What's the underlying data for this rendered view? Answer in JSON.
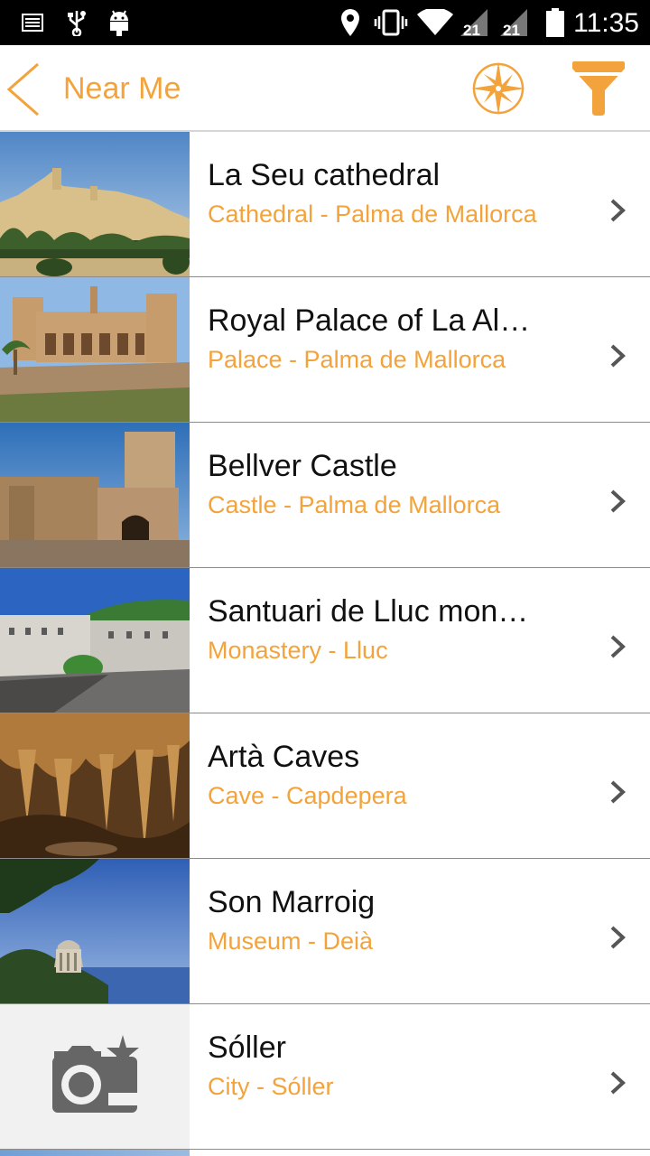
{
  "status_bar": {
    "time": "11:35",
    "icons": [
      "keyboard-icon",
      "usb-icon",
      "android-icon",
      "location-icon",
      "vibrate-icon",
      "wifi-icon",
      "signal-1-icon",
      "signal-2-icon",
      "battery-icon"
    ],
    "sim1_label": "21",
    "sim2_label": "21"
  },
  "app_bar": {
    "title": "Near Me",
    "accent_color": "#f3a33b",
    "icons": [
      "back-arrow-icon",
      "compass-icon",
      "filter-icon"
    ]
  },
  "places": [
    {
      "title": "La Seu cathedral",
      "subtitle": "Cathedral - Palma de Mallorca",
      "thumb": "cathedral-photo"
    },
    {
      "title": "Royal Palace of La Al…",
      "subtitle": "Palace - Palma de Mallorca",
      "thumb": "palace-photo"
    },
    {
      "title": "Bellver Castle",
      "subtitle": "Castle - Palma de Mallorca",
      "thumb": "castle-photo"
    },
    {
      "title": "Santuari de Lluc mon…",
      "subtitle": "Monastery - Lluc",
      "thumb": "monastery-photo"
    },
    {
      "title": "Artà Caves",
      "subtitle": "Cave - Capdepera",
      "thumb": "cave-photo"
    },
    {
      "title": "Son Marroig",
      "subtitle": "Museum - Deià",
      "thumb": "museum-photo"
    },
    {
      "title": "Sóller",
      "subtitle": "City - Sóller",
      "thumb": "placeholder-camera-icon"
    }
  ]
}
